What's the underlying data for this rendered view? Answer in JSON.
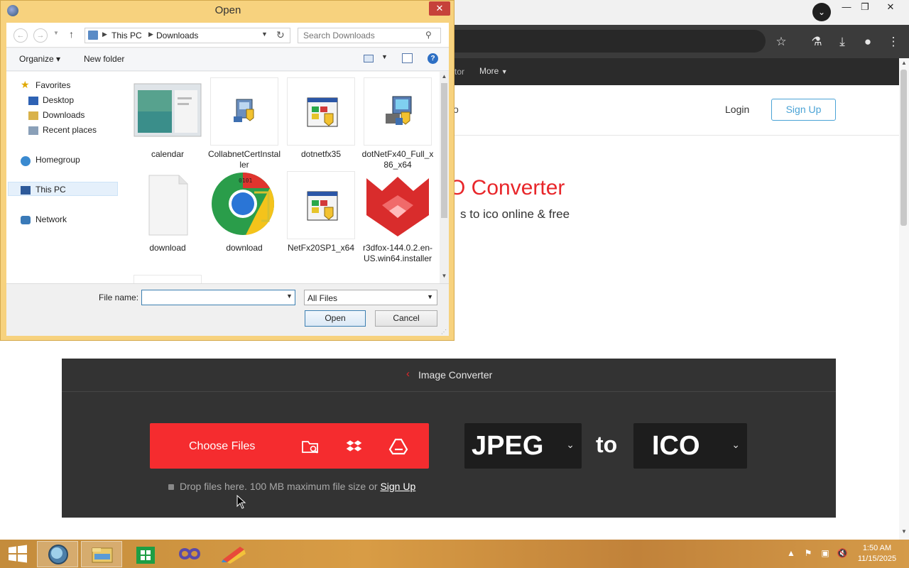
{
  "browser": {
    "nav": {
      "partial_item": "tor",
      "more_label": "More"
    },
    "header": {
      "logo_partial": "o",
      "login_label": "Login",
      "signup_label": "Sign Up"
    },
    "hero": {
      "title_partial": "O Converter",
      "subtitle_partial": "s to ico online & free"
    }
  },
  "converter": {
    "header_label": "Image Converter",
    "choose_files_label": "Choose Files",
    "from_format": "JPEG",
    "to_word": "to",
    "to_format": "ICO",
    "drop_text": "Drop files here. 100 MB maximum file size or ",
    "drop_signup": "Sign Up"
  },
  "dialog": {
    "title": "Open",
    "breadcrumb": {
      "root": "This PC",
      "folder": "Downloads"
    },
    "search_placeholder": "Search Downloads",
    "toolbar": {
      "organize": "Organize ▾",
      "new_folder": "New folder"
    },
    "nav_pane": {
      "favorites": "Favorites",
      "desktop": "Desktop",
      "downloads": "Downloads",
      "recent": "Recent places",
      "homegroup": "Homegroup",
      "thispc": "This PC",
      "network": "Network"
    },
    "files": [
      {
        "name": "calendar",
        "icon": "image-thumbnail"
      },
      {
        "name": "CollabnetCertInstaller",
        "icon": "installer-icon"
      },
      {
        "name": "dotnetfx35",
        "icon": "setup-icon"
      },
      {
        "name": "dotNetFx40_Full_x86_x64",
        "icon": "installer-icon"
      },
      {
        "name": "download",
        "icon": "blank-file-icon"
      },
      {
        "name": "download",
        "icon": "chrome-icon"
      },
      {
        "name": "NetFx20SP1_x64",
        "icon": "setup-icon"
      },
      {
        "name": "r3dfox-144.0.2.en-US.win64.installer",
        "icon": "r3dfox-icon"
      }
    ],
    "file_name_label": "File name:",
    "file_name_value": "",
    "file_type": "All Files",
    "open_label": "Open",
    "cancel_label": "Cancel"
  },
  "taskbar": {
    "time": "1:50 AM",
    "date": "11/15/2025"
  },
  "colors": {
    "accent_red": "#f52c2f",
    "dialog_frame": "#f7d27e",
    "taskbar": "#d89c45"
  }
}
